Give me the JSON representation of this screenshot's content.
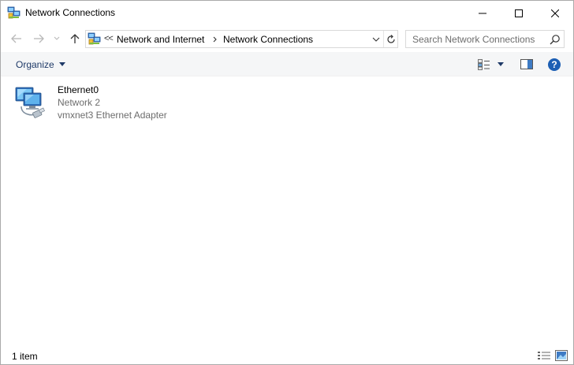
{
  "window": {
    "title": "Network Connections"
  },
  "address": {
    "overflow": "<<",
    "breadcrumbs": [
      {
        "label": "Network and Internet"
      },
      {
        "label": "Network Connections"
      }
    ]
  },
  "search": {
    "placeholder": "Search Network Connections",
    "value": ""
  },
  "commandbar": {
    "organize_label": "Organize"
  },
  "connections": [
    {
      "name": "Ethernet0",
      "network": "Network 2",
      "adapter": "vmxnet3 Ethernet Adapter",
      "icon": "network-adapter-icon"
    }
  ],
  "status": {
    "item_count": "1 item"
  },
  "colors": {
    "command_bar_bg": "#f5f6f7",
    "help_blue": "#1d5fb4",
    "secondary_text": "#6d6d6d"
  }
}
